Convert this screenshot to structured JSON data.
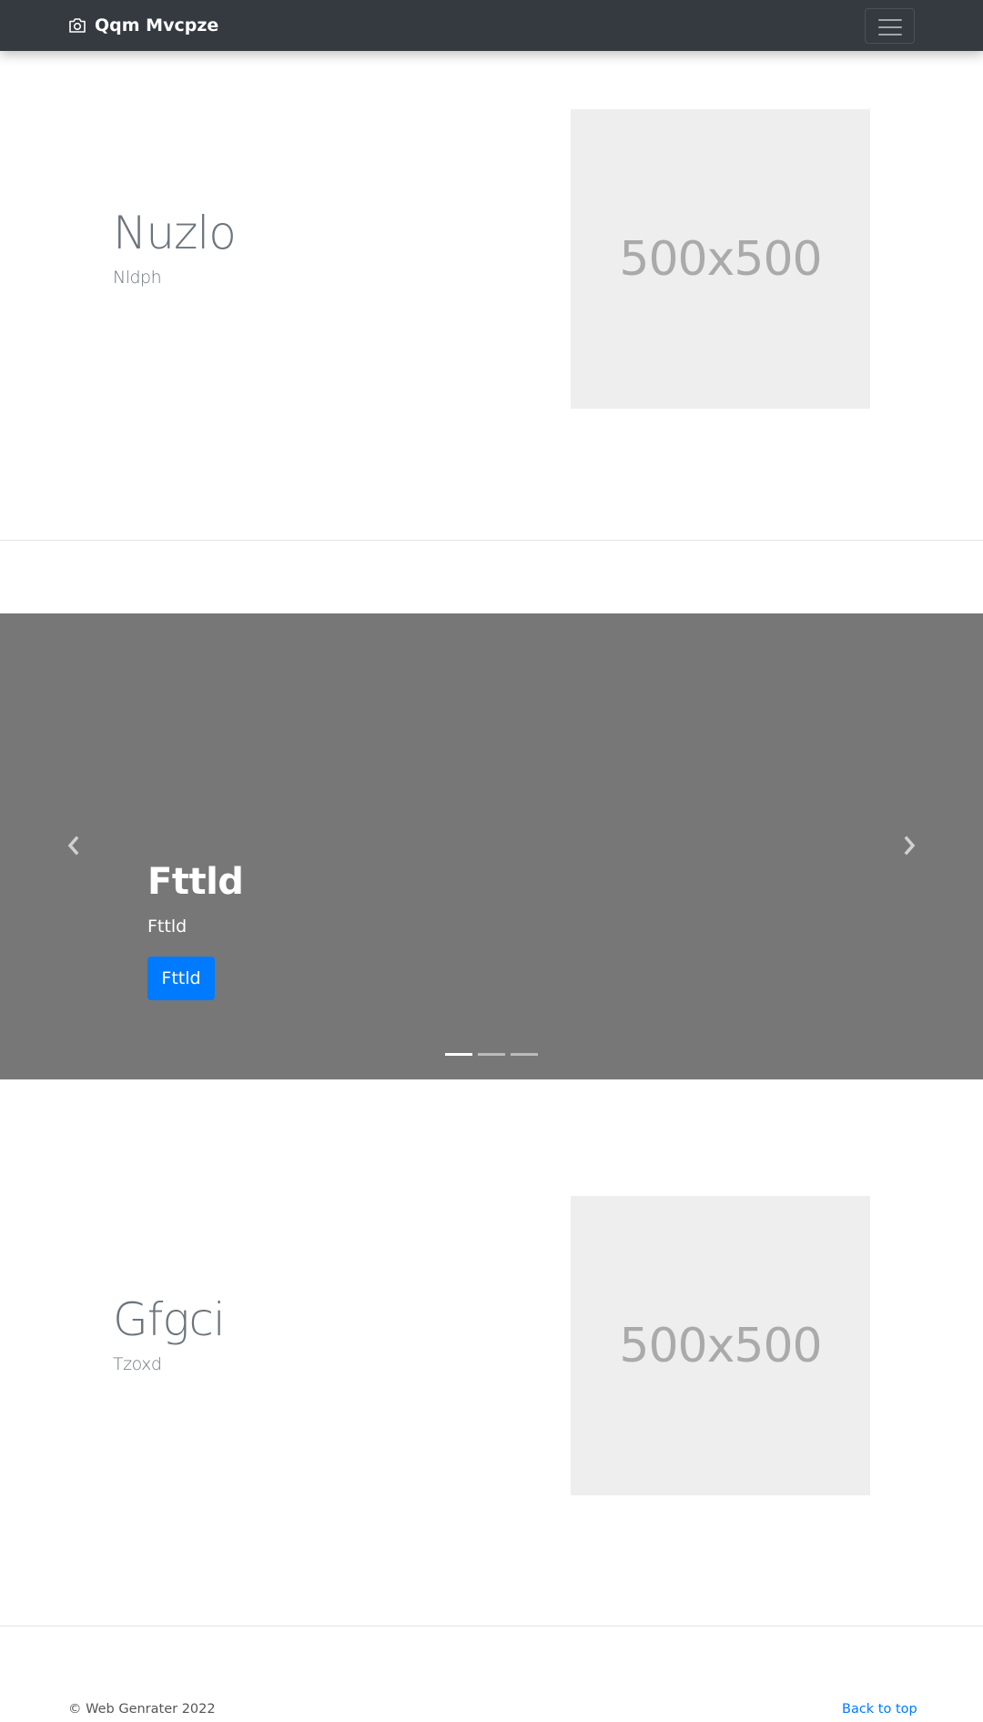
{
  "navbar": {
    "brand": "Qqm Mvcpze",
    "brand_icon": "camera-icon",
    "toggler_icon": "hamburger-menu-icon"
  },
  "features": [
    {
      "title": "Nuzlo",
      "subtitle": "Nldph",
      "image_label": "500x500"
    },
    {
      "title": "Gfgci",
      "subtitle": "Tzoxd",
      "image_label": "500x500"
    }
  ],
  "carousel": {
    "title": "Fttld",
    "subtitle": "Fttld",
    "button_label": "Fttld",
    "prev_icon": "chevron-left-icon",
    "next_icon": "chevron-right-icon",
    "slide_count": 3,
    "active_slide": 1,
    "colors": {
      "slide_bg": "#777777",
      "button_bg": "#007bff"
    }
  },
  "footer": {
    "copyright": "© Web Genrater 2022",
    "back_to_top": "Back to top"
  },
  "colors": {
    "navbar_bg": "#343a40",
    "muted_text": "#6c757d",
    "link": "#007bff",
    "placeholder_bg": "#eeeeee",
    "placeholder_text": "#aaaaaa"
  }
}
